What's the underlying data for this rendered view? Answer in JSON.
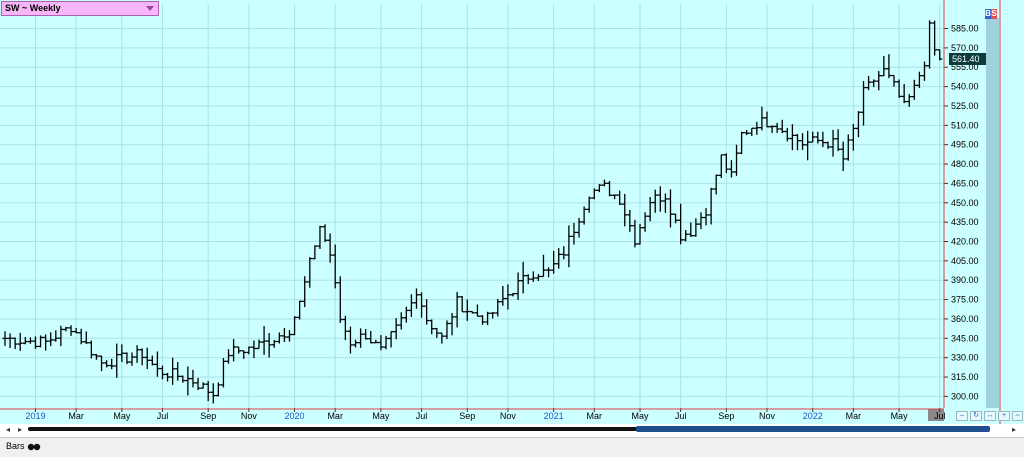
{
  "header": {
    "symbol_label": "SW ~ Weekly"
  },
  "badge": {
    "b": "B",
    "s": "S",
    "b_color": "#3a5fd0",
    "s_color": "#e05050"
  },
  "status": {
    "mode_label": "Bars"
  },
  "colors": {
    "background": "#ccffff",
    "grid": "#a9e3ea",
    "bars": "#000000",
    "axis_line": "#e04040",
    "last_price_bg": "#0b3b3b",
    "month_label": "#000000",
    "year_label": "#1a56c8"
  },
  "chart_data": {
    "type": "ohlc",
    "title": "SW ~ Weekly",
    "last_price": "561.40",
    "yticks": [
      300.0,
      315.0,
      330.0,
      345.0,
      360.0,
      375.0,
      390.0,
      405.0,
      420.0,
      435.0,
      450.0,
      465.0,
      480.0,
      495.0,
      510.0,
      525.0,
      540.0,
      555.0,
      570.0,
      585.0
    ],
    "ylim": [
      291,
      604
    ],
    "grid": true,
    "x_labels": [
      {
        "text": "2019",
        "week": 6,
        "year": true
      },
      {
        "text": "Mar",
        "week": 14
      },
      {
        "text": "May",
        "week": 23
      },
      {
        "text": "Jul",
        "week": 31
      },
      {
        "text": "Sep",
        "week": 40
      },
      {
        "text": "Nov",
        "week": 48
      },
      {
        "text": "2020",
        "week": 57,
        "year": true
      },
      {
        "text": "Mar",
        "week": 65
      },
      {
        "text": "May",
        "week": 74
      },
      {
        "text": "Jul",
        "week": 82
      },
      {
        "text": "Sep",
        "week": 91
      },
      {
        "text": "Nov",
        "week": 99
      },
      {
        "text": "2021",
        "week": 108,
        "year": true
      },
      {
        "text": "Mar",
        "week": 116
      },
      {
        "text": "May",
        "week": 125
      },
      {
        "text": "Jul",
        "week": 133
      },
      {
        "text": "Sep",
        "week": 142
      },
      {
        "text": "Nov",
        "week": 150
      },
      {
        "text": "2022",
        "week": 159,
        "year": true
      },
      {
        "text": "Mar",
        "week": 167
      },
      {
        "text": "May",
        "week": 176
      },
      {
        "text": "Jul",
        "week": 184
      }
    ],
    "anchors": [
      [
        0,
        345
      ],
      [
        4,
        343
      ],
      [
        8,
        342
      ],
      [
        10,
        347
      ],
      [
        13,
        354
      ],
      [
        16,
        340
      ],
      [
        19,
        326
      ],
      [
        24,
        330
      ],
      [
        27,
        333
      ],
      [
        30,
        320
      ],
      [
        34,
        316
      ],
      [
        37,
        312
      ],
      [
        41,
        302
      ],
      [
        44,
        334
      ],
      [
        49,
        338
      ],
      [
        53,
        345
      ],
      [
        56,
        352
      ],
      [
        58,
        372
      ],
      [
        61,
        418
      ],
      [
        62,
        432
      ],
      [
        64,
        410
      ],
      [
        66,
        360
      ],
      [
        68,
        342
      ],
      [
        71,
        348
      ],
      [
        74,
        335
      ],
      [
        77,
        352
      ],
      [
        80,
        372
      ],
      [
        81,
        383
      ],
      [
        83,
        360
      ],
      [
        86,
        345
      ],
      [
        89,
        373
      ],
      [
        92,
        364
      ],
      [
        95,
        360
      ],
      [
        98,
        375
      ],
      [
        101,
        387
      ],
      [
        104,
        396
      ],
      [
        107,
        396
      ],
      [
        110,
        412
      ],
      [
        112,
        430
      ],
      [
        115,
        458
      ],
      [
        118,
        462
      ],
      [
        121,
        453
      ],
      [
        124,
        422
      ],
      [
        127,
        452
      ],
      [
        130,
        456
      ],
      [
        133,
        425
      ],
      [
        135,
        428
      ],
      [
        138,
        445
      ],
      [
        141,
        485
      ],
      [
        143,
        470
      ],
      [
        145,
        503
      ],
      [
        148,
        512
      ],
      [
        151,
        513
      ],
      [
        154,
        504
      ],
      [
        157,
        496
      ],
      [
        160,
        498
      ],
      [
        163,
        496
      ],
      [
        165,
        484
      ],
      [
        167,
        506
      ],
      [
        169,
        535
      ],
      [
        171,
        545
      ],
      [
        173,
        552
      ],
      [
        175,
        540
      ],
      [
        177,
        524
      ],
      [
        179,
        538
      ],
      [
        181,
        560
      ],
      [
        182,
        585
      ],
      [
        183,
        568
      ],
      [
        184,
        561
      ]
    ]
  }
}
